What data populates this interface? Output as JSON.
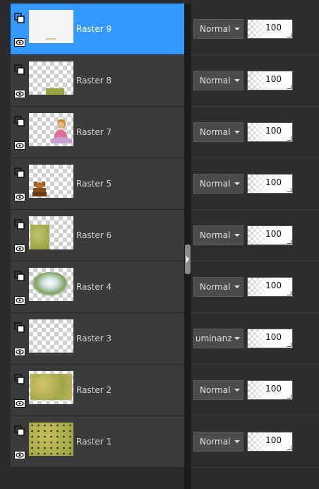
{
  "layers": [
    {
      "name": "Raster 9",
      "selected": true,
      "blend_mode": "Normal",
      "opacity": 100
    },
    {
      "name": "Raster 8",
      "selected": false,
      "blend_mode": "Normal",
      "opacity": 100
    },
    {
      "name": "Raster 7",
      "selected": false,
      "blend_mode": "Normal",
      "opacity": 100
    },
    {
      "name": "Raster 5",
      "selected": false,
      "blend_mode": "Normal",
      "opacity": 100
    },
    {
      "name": "Raster 6",
      "selected": false,
      "blend_mode": "Normal",
      "opacity": 100
    },
    {
      "name": "Raster 4",
      "selected": false,
      "blend_mode": "Normal",
      "opacity": 100
    },
    {
      "name": "Raster 3",
      "selected": false,
      "blend_mode": "uminanz (\\",
      "opacity": 100
    },
    {
      "name": "Raster 2",
      "selected": false,
      "blend_mode": "Normal",
      "opacity": 100
    },
    {
      "name": "Raster 1",
      "selected": false,
      "blend_mode": "Normal",
      "opacity": 100
    }
  ],
  "icons": {
    "lock": "layer-lock-icon",
    "visibility": "eye-icon",
    "splitter": "chevron-right-icon"
  },
  "colors": {
    "selection": "#3399ff",
    "row": "#3b3b3b",
    "panel": "#2b2b2b"
  }
}
